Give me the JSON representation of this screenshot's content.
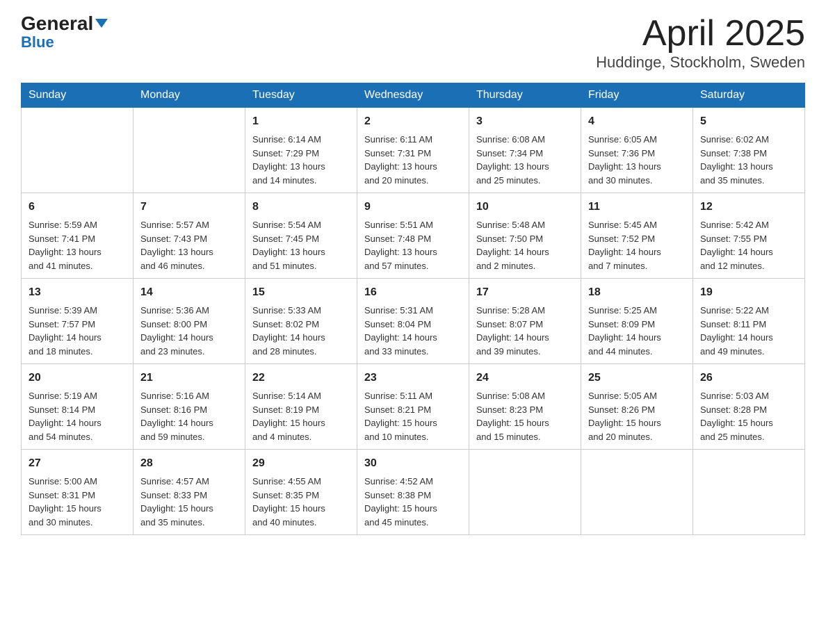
{
  "logo": {
    "general": "General",
    "triangle": "▼",
    "blue": "Blue"
  },
  "title": "April 2025",
  "subtitle": "Huddinge, Stockholm, Sweden",
  "days_of_week": [
    "Sunday",
    "Monday",
    "Tuesday",
    "Wednesday",
    "Thursday",
    "Friday",
    "Saturday"
  ],
  "weeks": [
    [
      {
        "day": "",
        "info": ""
      },
      {
        "day": "",
        "info": ""
      },
      {
        "day": "1",
        "info": "Sunrise: 6:14 AM\nSunset: 7:29 PM\nDaylight: 13 hours\nand 14 minutes."
      },
      {
        "day": "2",
        "info": "Sunrise: 6:11 AM\nSunset: 7:31 PM\nDaylight: 13 hours\nand 20 minutes."
      },
      {
        "day": "3",
        "info": "Sunrise: 6:08 AM\nSunset: 7:34 PM\nDaylight: 13 hours\nand 25 minutes."
      },
      {
        "day": "4",
        "info": "Sunrise: 6:05 AM\nSunset: 7:36 PM\nDaylight: 13 hours\nand 30 minutes."
      },
      {
        "day": "5",
        "info": "Sunrise: 6:02 AM\nSunset: 7:38 PM\nDaylight: 13 hours\nand 35 minutes."
      }
    ],
    [
      {
        "day": "6",
        "info": "Sunrise: 5:59 AM\nSunset: 7:41 PM\nDaylight: 13 hours\nand 41 minutes."
      },
      {
        "day": "7",
        "info": "Sunrise: 5:57 AM\nSunset: 7:43 PM\nDaylight: 13 hours\nand 46 minutes."
      },
      {
        "day": "8",
        "info": "Sunrise: 5:54 AM\nSunset: 7:45 PM\nDaylight: 13 hours\nand 51 minutes."
      },
      {
        "day": "9",
        "info": "Sunrise: 5:51 AM\nSunset: 7:48 PM\nDaylight: 13 hours\nand 57 minutes."
      },
      {
        "day": "10",
        "info": "Sunrise: 5:48 AM\nSunset: 7:50 PM\nDaylight: 14 hours\nand 2 minutes."
      },
      {
        "day": "11",
        "info": "Sunrise: 5:45 AM\nSunset: 7:52 PM\nDaylight: 14 hours\nand 7 minutes."
      },
      {
        "day": "12",
        "info": "Sunrise: 5:42 AM\nSunset: 7:55 PM\nDaylight: 14 hours\nand 12 minutes."
      }
    ],
    [
      {
        "day": "13",
        "info": "Sunrise: 5:39 AM\nSunset: 7:57 PM\nDaylight: 14 hours\nand 18 minutes."
      },
      {
        "day": "14",
        "info": "Sunrise: 5:36 AM\nSunset: 8:00 PM\nDaylight: 14 hours\nand 23 minutes."
      },
      {
        "day": "15",
        "info": "Sunrise: 5:33 AM\nSunset: 8:02 PM\nDaylight: 14 hours\nand 28 minutes."
      },
      {
        "day": "16",
        "info": "Sunrise: 5:31 AM\nSunset: 8:04 PM\nDaylight: 14 hours\nand 33 minutes."
      },
      {
        "day": "17",
        "info": "Sunrise: 5:28 AM\nSunset: 8:07 PM\nDaylight: 14 hours\nand 39 minutes."
      },
      {
        "day": "18",
        "info": "Sunrise: 5:25 AM\nSunset: 8:09 PM\nDaylight: 14 hours\nand 44 minutes."
      },
      {
        "day": "19",
        "info": "Sunrise: 5:22 AM\nSunset: 8:11 PM\nDaylight: 14 hours\nand 49 minutes."
      }
    ],
    [
      {
        "day": "20",
        "info": "Sunrise: 5:19 AM\nSunset: 8:14 PM\nDaylight: 14 hours\nand 54 minutes."
      },
      {
        "day": "21",
        "info": "Sunrise: 5:16 AM\nSunset: 8:16 PM\nDaylight: 14 hours\nand 59 minutes."
      },
      {
        "day": "22",
        "info": "Sunrise: 5:14 AM\nSunset: 8:19 PM\nDaylight: 15 hours\nand 4 minutes."
      },
      {
        "day": "23",
        "info": "Sunrise: 5:11 AM\nSunset: 8:21 PM\nDaylight: 15 hours\nand 10 minutes."
      },
      {
        "day": "24",
        "info": "Sunrise: 5:08 AM\nSunset: 8:23 PM\nDaylight: 15 hours\nand 15 minutes."
      },
      {
        "day": "25",
        "info": "Sunrise: 5:05 AM\nSunset: 8:26 PM\nDaylight: 15 hours\nand 20 minutes."
      },
      {
        "day": "26",
        "info": "Sunrise: 5:03 AM\nSunset: 8:28 PM\nDaylight: 15 hours\nand 25 minutes."
      }
    ],
    [
      {
        "day": "27",
        "info": "Sunrise: 5:00 AM\nSunset: 8:31 PM\nDaylight: 15 hours\nand 30 minutes."
      },
      {
        "day": "28",
        "info": "Sunrise: 4:57 AM\nSunset: 8:33 PM\nDaylight: 15 hours\nand 35 minutes."
      },
      {
        "day": "29",
        "info": "Sunrise: 4:55 AM\nSunset: 8:35 PM\nDaylight: 15 hours\nand 40 minutes."
      },
      {
        "day": "30",
        "info": "Sunrise: 4:52 AM\nSunset: 8:38 PM\nDaylight: 15 hours\nand 45 minutes."
      },
      {
        "day": "",
        "info": ""
      },
      {
        "day": "",
        "info": ""
      },
      {
        "day": "",
        "info": ""
      }
    ]
  ]
}
